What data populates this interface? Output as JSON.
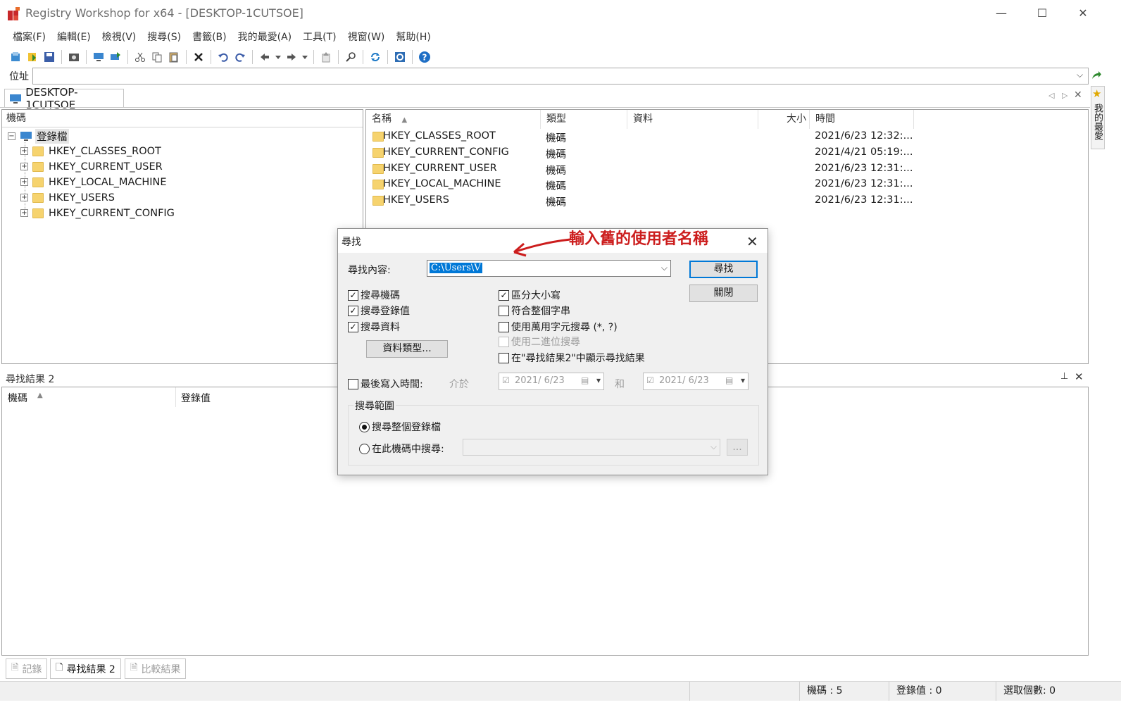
{
  "window": {
    "title": "Registry Workshop for x64 - [DESKTOP-1CUTSOE]",
    "controls": {
      "minimize": "—",
      "maximize": "☐",
      "close": "✕"
    }
  },
  "menu": [
    "檔案(F)",
    "編輯(E)",
    "檢視(V)",
    "搜尋(S)",
    "書籤(B)",
    "我的最愛(A)",
    "工具(T)",
    "視窗(W)",
    "幫助(H)"
  ],
  "address": {
    "label": "位址",
    "value": ""
  },
  "doc_tab": {
    "label": "DESKTOP-1CUTSOE"
  },
  "favorites_strip": {
    "label": "我的最愛"
  },
  "tree": {
    "header": "機碼",
    "root": "登錄檔",
    "items": [
      "HKEY_CLASSES_ROOT",
      "HKEY_CURRENT_USER",
      "HKEY_LOCAL_MACHINE",
      "HKEY_USERS",
      "HKEY_CURRENT_CONFIG"
    ]
  },
  "list": {
    "columns": {
      "name": "名稱",
      "type": "類型",
      "data": "資料",
      "size": "大小",
      "time": "時間"
    },
    "rows": [
      {
        "name": "HKEY_CLASSES_ROOT",
        "type": "機碼",
        "time": "2021/6/23 12:32:..."
      },
      {
        "name": "HKEY_CURRENT_CONFIG",
        "type": "機碼",
        "time": "2021/4/21 05:19:..."
      },
      {
        "name": "HKEY_CURRENT_USER",
        "type": "機碼",
        "time": "2021/6/23 12:31:..."
      },
      {
        "name": "HKEY_LOCAL_MACHINE",
        "type": "機碼",
        "time": "2021/6/23 12:31:..."
      },
      {
        "name": "HKEY_USERS",
        "type": "機碼",
        "time": "2021/6/23 12:31:..."
      }
    ]
  },
  "results": {
    "title": "尋找結果 2",
    "columns": {
      "key": "機碼",
      "value": "登錄值"
    }
  },
  "bottom_tabs": [
    "記錄",
    "尋找結果 2",
    "比較結果"
  ],
  "status": {
    "keys": "機碼 : 5",
    "values": "登錄值 : 0",
    "selected": "選取個數: 0"
  },
  "dialog": {
    "title": "尋找",
    "find_label": "尋找內容:",
    "find_value": "C:\\Users\\V",
    "find_button": "尋找",
    "close_button": "關閉",
    "options_left": [
      {
        "label": "搜尋機碼",
        "checked": true
      },
      {
        "label": "搜尋登錄值",
        "checked": true
      },
      {
        "label": "搜尋資料",
        "checked": true
      }
    ],
    "options_right": [
      {
        "label": "區分大小寫",
        "checked": true
      },
      {
        "label": "符合整個字串",
        "checked": false
      },
      {
        "label": "使用萬用字元搜尋 (*, ?)",
        "checked": false
      },
      {
        "label": "使用二進位搜尋",
        "checked": false,
        "disabled": true
      },
      {
        "label": "在\"尋找結果2\"中顯示尋找結果",
        "checked": false
      }
    ],
    "data_type_button": "資料類型...",
    "last_write_label": "最後寫入時間:",
    "between_label": "介於",
    "and_label": "和",
    "date_from": "2021/ 6/23",
    "date_to": "2021/ 6/23",
    "scope_title": "搜尋範圍",
    "scope_all": "搜尋整個登錄檔",
    "scope_key": "在此機碼中搜尋:",
    "browse_button": "..."
  },
  "annotation": {
    "text": "輸入舊的使用者名稱",
    "color": "#cc1d1d"
  },
  "colors": {
    "accent": "#0078d7",
    "folder": "#f6d36e"
  }
}
